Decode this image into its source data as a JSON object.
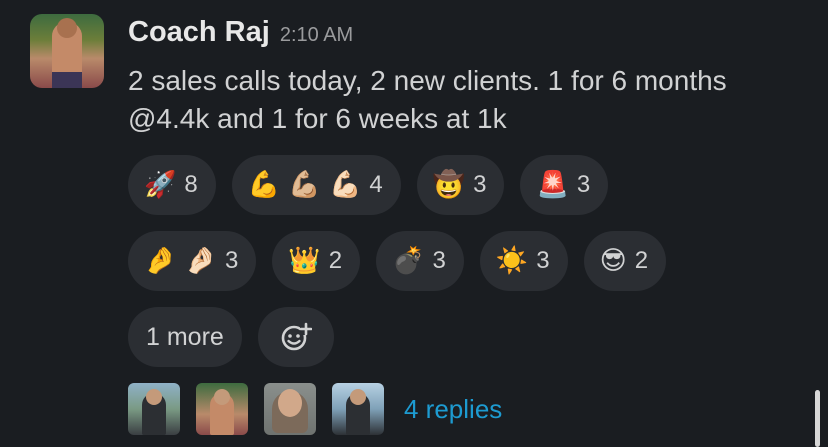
{
  "message": {
    "author": "Coach Raj",
    "timestamp": "2:10 AM",
    "text": "2 sales calls today, 2 new clients. 1 for 6 months @4.4k and 1 for 6 weeks at 1k"
  },
  "reactions": {
    "row1": [
      {
        "emoji": "🚀",
        "icon": "rocket-icon",
        "count": "8"
      },
      {
        "emoji": "💪 💪🏼 💪🏻",
        "icon": "flexed-biceps-icon",
        "count": "4"
      },
      {
        "emoji": "🤠",
        "icon": "cowboy-face-icon",
        "count": "3"
      },
      {
        "emoji": "🚨",
        "icon": "siren-icon",
        "count": "3"
      }
    ],
    "row2": [
      {
        "emoji": "🤌 🤌🏻",
        "icon": "pinched-fingers-icon",
        "count": "3"
      },
      {
        "emoji": "👑",
        "icon": "crown-icon",
        "count": "2"
      },
      {
        "emoji": "💣",
        "icon": "bomb-icon",
        "count": "3"
      },
      {
        "emoji": "☀️",
        "icon": "sun-icon",
        "count": "3"
      },
      {
        "emoji": "😎",
        "icon": "sunglasses-face-icon",
        "count": "2"
      }
    ],
    "more_label": "1 more",
    "add_icon": "add-reaction-icon"
  },
  "thread": {
    "replies_label": "4 replies"
  },
  "colors": {
    "background": "#1a1d21",
    "pill": "#2b2e33",
    "link": "#1d9bd1",
    "text": "#d1d2d3"
  }
}
